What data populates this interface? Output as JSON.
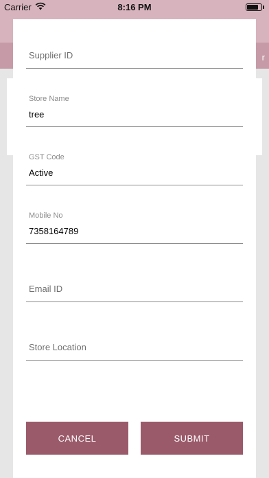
{
  "status_bar": {
    "carrier": "Carrier",
    "time": "8:16 PM"
  },
  "background": {
    "header_right_text": "r"
  },
  "form": {
    "fields": [
      {
        "label": "Supplier ID",
        "value": ""
      },
      {
        "label": "Store Name",
        "value": "tree"
      },
      {
        "label": "GST Code",
        "value": "Active"
      },
      {
        "label": "Mobile No",
        "value": "7358164789"
      },
      {
        "label": "Email ID",
        "value": ""
      },
      {
        "label": "Store Location",
        "value": ""
      }
    ],
    "cancel_label": "CANCEL",
    "submit_label": "SUBMIT"
  },
  "colors": {
    "button": "#9a5a6a",
    "header": "#d7b3bd",
    "divider": "#8c8c8c"
  }
}
